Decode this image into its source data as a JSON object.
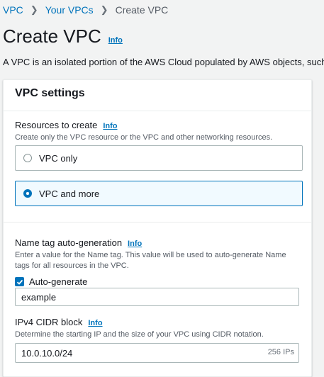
{
  "breadcrumb": {
    "items": [
      "VPC",
      "Your VPCs"
    ],
    "current": "Create VPC"
  },
  "page": {
    "title": "Create VPC",
    "info": "Info",
    "description": "A VPC is an isolated portion of the AWS Cloud populated by AWS objects, such a"
  },
  "vpc_settings": {
    "heading": "VPC settings",
    "resources": {
      "label": "Resources to create",
      "info": "Info",
      "hint": "Create only the VPC resource or the VPC and other networking resources.",
      "options": [
        {
          "label": "VPC only",
          "selected": false
        },
        {
          "label": "VPC and more",
          "selected": true
        }
      ]
    },
    "name_tag": {
      "label": "Name tag auto-generation",
      "info": "Info",
      "hint": "Enter a value for the Name tag. This value will be used to auto-generate Name tags for all resources in the VPC.",
      "checkbox_label": "Auto-generate",
      "checked": true,
      "value": "example"
    },
    "cidr": {
      "label": "IPv4 CIDR block",
      "info": "Info",
      "hint": "Determine the starting IP and the size of your VPC using CIDR notation.",
      "value": "10.0.10.0/24",
      "ip_count": "256 IPs"
    }
  }
}
